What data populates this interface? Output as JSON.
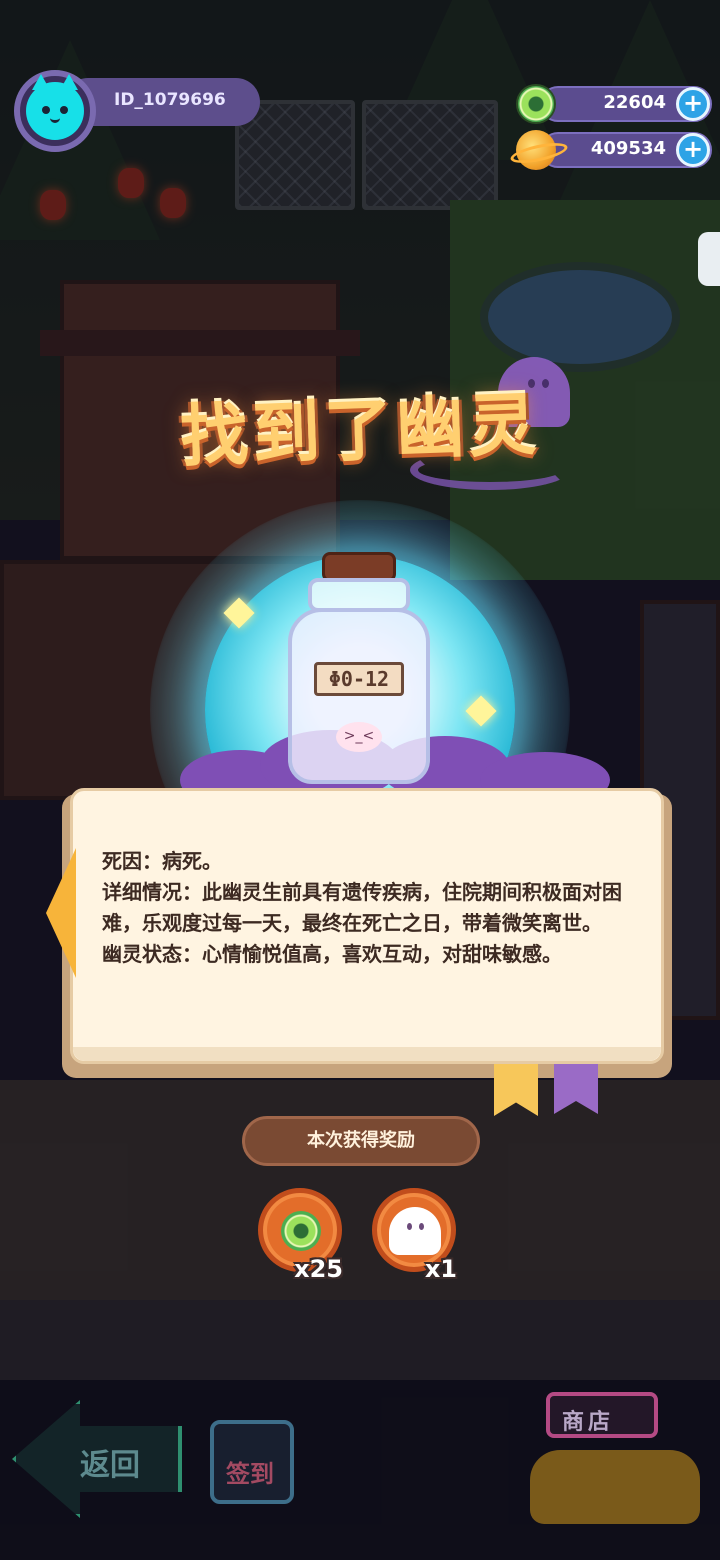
{
  "hud": {
    "user_id": "ID_1079696",
    "currencies": [
      {
        "icon": "donut-icon",
        "value": "22604"
      },
      {
        "icon": "planet-coin-icon",
        "value": "409534"
      }
    ]
  },
  "popup": {
    "title": "找到了幽灵",
    "bottle_label": "Φ0-12",
    "book": {
      "line1": "死因：病死。",
      "line2": "详细情况：此幽灵生前具有遗传疾病，住院期间积极面对困难，乐观度过每一天，最终在死亡之日，带着微笑离世。",
      "line3": "幽灵状态：心情愉悦值高，喜欢互动，对甜味敏感。"
    },
    "reward_title": "本次获得奖励",
    "rewards": [
      {
        "icon": "donut-icon",
        "count": "x25"
      },
      {
        "icon": "ghost-icon",
        "count": "x1"
      }
    ]
  },
  "nav": {
    "back_label": "返回",
    "signin_label": "签到",
    "shop_label": "商店"
  },
  "colors": {
    "accent_purple": "#5d4e8c",
    "title_orange": "#ffcf70",
    "orb_cyan": "#7ee6f3",
    "book_paper": "#fff4e1",
    "reward_orange": "#e36d2a"
  }
}
